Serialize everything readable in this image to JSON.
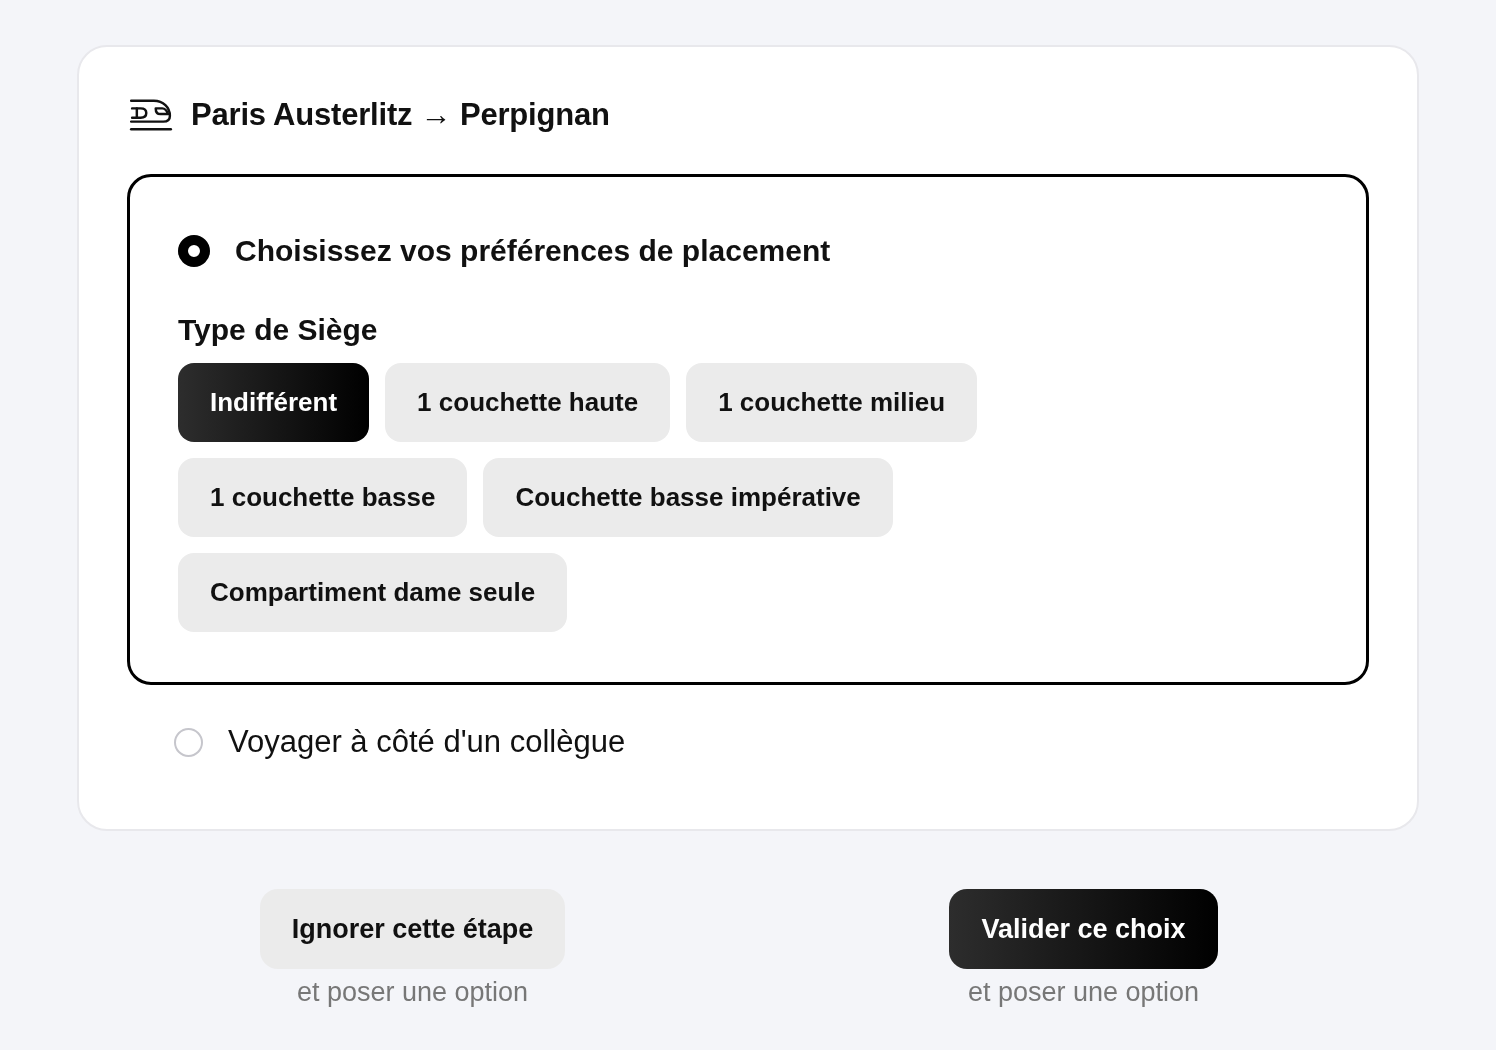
{
  "route": {
    "title": "Paris Austerlitz → Perpignan"
  },
  "options": [
    {
      "kind": "seat_preferences",
      "label": "Choisissez vos préférences de placement",
      "selected": true,
      "section_title": "Type de Siège",
      "seat_types": [
        {
          "label": "Indifférent",
          "selected": true
        },
        {
          "label": "1 couchette haute",
          "selected": false
        },
        {
          "label": "1 couchette milieu",
          "selected": false
        },
        {
          "label": "1 couchette basse",
          "selected": false
        },
        {
          "label": "Couchette basse impérative",
          "selected": false
        },
        {
          "label": "Compartiment dame seule",
          "selected": false
        }
      ]
    },
    {
      "kind": "plain",
      "label": "Voyager à côté d'un collègue",
      "selected": false
    }
  ],
  "actions": [
    {
      "kind": "secondary",
      "label": "Ignorer cette étape",
      "sublabel": "et poser une option"
    },
    {
      "kind": "primary",
      "label": "Valider ce choix",
      "sublabel": "et poser une option"
    }
  ]
}
